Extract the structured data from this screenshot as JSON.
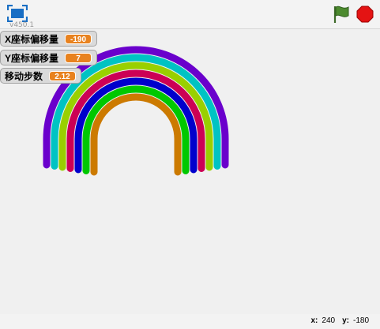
{
  "version": "v450.1",
  "monitors": [
    {
      "label": "X座标偏移量",
      "value": "-190"
    },
    {
      "label": "Y座标偏移量",
      "value": "7"
    },
    {
      "label": "移动步数",
      "value": "2.12"
    }
  ],
  "rainbow_colors": [
    "#6a00cc",
    "#00c3c3",
    "#99d000",
    "#cc0055",
    "#0000cc",
    "#00c800",
    "#cc7a00"
  ],
  "colors": {
    "monitor_value_bg": "#e8821f",
    "stage_bg": "#f0f0f0"
  },
  "status": {
    "x_label": "x:",
    "x_value": "240",
    "y_label": "y:",
    "y_value": "-180"
  }
}
